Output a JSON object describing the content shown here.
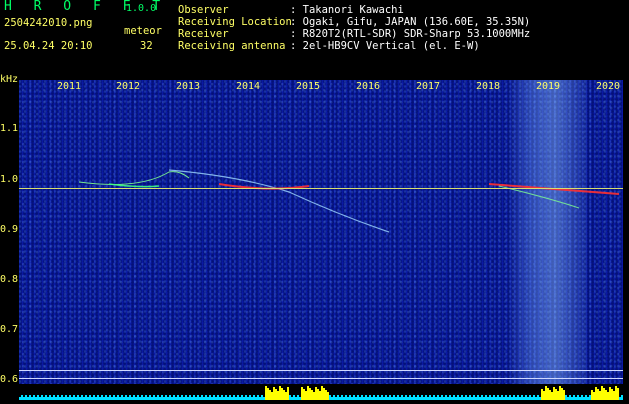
{
  "header": {
    "app_name": "H R O F F T",
    "version": "1.0.0",
    "filename": "2504242010.png",
    "timestamp": "25.04.24 20:10",
    "meteor_label": "meteor",
    "meteor_count": "32",
    "fields": [
      {
        "label": "Observer",
        "value": ": Takanori Kawachi"
      },
      {
        "label": "Receiving Location",
        "value": ": Ogaki, Gifu, JAPAN (136.60E, 35.35N)"
      },
      {
        "label": "Receiver",
        "value": ": R820T2(RTL-SDR) SDR-Sharp 53.1000MHz"
      },
      {
        "label": "Receiving antenna",
        "value": ": 2el-HB9CV Vertical (el. E-W)"
      }
    ]
  },
  "axes": {
    "y_unit": "kHz",
    "y_ticks": [
      "1.1",
      "1.0",
      "0.9",
      "0.8",
      "0.7",
      "0.6"
    ],
    "x_ticks": [
      "2011",
      "2012",
      "2013",
      "2014",
      "2015",
      "2016",
      "2017",
      "2018",
      "2019",
      "2020"
    ]
  },
  "colors": {
    "background": "#000000",
    "plot_bg": "#0b1ba6",
    "label_yellow": "#ffff66",
    "logo_green": "#00ff66",
    "signal_line": "#d8e070",
    "meteor_red": "#ff3030",
    "meteor_green": "#40ff80",
    "spectrum_cyan": "#00e0ff",
    "spectrum_yellow": "#ffff00"
  }
}
